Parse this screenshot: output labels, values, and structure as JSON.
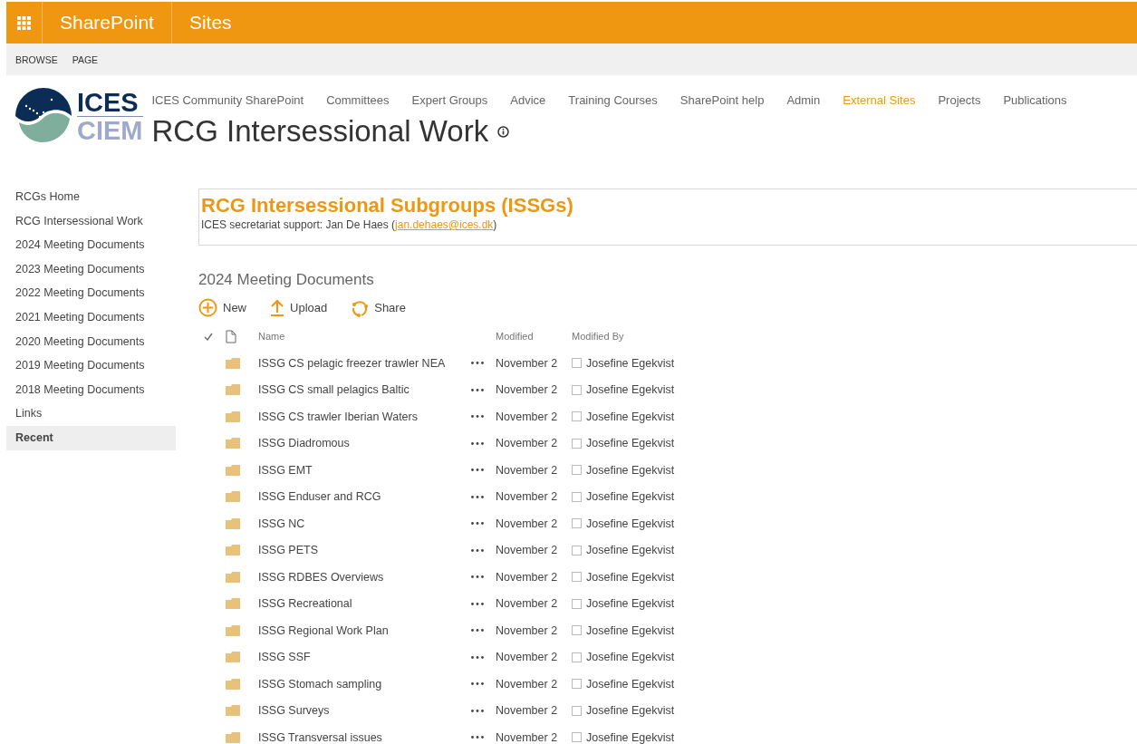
{
  "suite_bar": {
    "app_name": "SharePoint",
    "section": "Sites"
  },
  "ribbon_tabs": [
    {
      "label": "BROWSE"
    },
    {
      "label": "PAGE"
    }
  ],
  "logo": {
    "top": "ICES",
    "bottom": "CIEM"
  },
  "top_nav": [
    {
      "label": "ICES Community SharePoint",
      "selected": false
    },
    {
      "label": "Committees",
      "selected": false
    },
    {
      "label": "Expert Groups",
      "selected": false
    },
    {
      "label": "Advice",
      "selected": false
    },
    {
      "label": "Training Courses",
      "selected": false
    },
    {
      "label": "SharePoint help",
      "selected": false
    },
    {
      "label": "Admin",
      "selected": false
    },
    {
      "label": "External Sites",
      "selected": true
    },
    {
      "label": "Projects",
      "selected": false
    },
    {
      "label": "Publications",
      "selected": false
    }
  ],
  "site_title": "RCG Intersessional Work",
  "sidebar": {
    "items": [
      {
        "label": "RCGs Home",
        "selected": false
      },
      {
        "label": "RCG Intersessional Work",
        "selected": false
      },
      {
        "label": "2024 Meeting Documents",
        "selected": false
      },
      {
        "label": "2023 Meeting Documents",
        "selected": false
      },
      {
        "label": "2022 Meeting Documents",
        "selected": false
      },
      {
        "label": "2021 Meeting Documents",
        "selected": false
      },
      {
        "label": "2020 Meeting Documents",
        "selected": false
      },
      {
        "label": "2019 Meeting Documents",
        "selected": false
      },
      {
        "label": "2018 Meeting Documents",
        "selected": false
      },
      {
        "label": "Links",
        "selected": false
      },
      {
        "label": "Recent",
        "selected": true
      }
    ]
  },
  "banner": {
    "heading": "RCG Intersessional Subgroups (ISSGs)",
    "text_before": "ICES secretariat support: Jan De Haes (",
    "email": "jan.dehaes@ices.dk",
    "text_after": ")"
  },
  "library": {
    "title": "2024 Meeting Documents",
    "actions": [
      {
        "kind": "new",
        "label": "New"
      },
      {
        "kind": "upload",
        "label": "Upload"
      },
      {
        "kind": "share",
        "label": "Share"
      }
    ],
    "columns": {
      "name": "Name",
      "modified": "Modified",
      "modified_by": "Modified By"
    },
    "rows": [
      {
        "name": "ISSG CS pelagic freezer trawler NEA",
        "modified": "November 2",
        "modified_by": "Josefine Egekvist"
      },
      {
        "name": "ISSG CS small pelagics Baltic",
        "modified": "November 2",
        "modified_by": "Josefine Egekvist"
      },
      {
        "name": "ISSG CS trawler Iberian Waters",
        "modified": "November 2",
        "modified_by": "Josefine Egekvist"
      },
      {
        "name": "ISSG Diadromous",
        "modified": "November 2",
        "modified_by": "Josefine Egekvist"
      },
      {
        "name": "ISSG EMT",
        "modified": "November 2",
        "modified_by": "Josefine Egekvist"
      },
      {
        "name": "ISSG Enduser and RCG",
        "modified": "November 2",
        "modified_by": "Josefine Egekvist"
      },
      {
        "name": "ISSG NC",
        "modified": "November 2",
        "modified_by": "Josefine Egekvist"
      },
      {
        "name": "ISSG PETS",
        "modified": "November 2",
        "modified_by": "Josefine Egekvist"
      },
      {
        "name": "ISSG RDBES Overviews",
        "modified": "November 2",
        "modified_by": "Josefine Egekvist"
      },
      {
        "name": "ISSG Recreational",
        "modified": "November 2",
        "modified_by": "Josefine Egekvist"
      },
      {
        "name": "ISSG Regional Work Plan",
        "modified": "November 2",
        "modified_by": "Josefine Egekvist"
      },
      {
        "name": "ISSG SSF",
        "modified": "November 2",
        "modified_by": "Josefine Egekvist"
      },
      {
        "name": "ISSG Stomach sampling",
        "modified": "November 2",
        "modified_by": "Josefine Egekvist"
      },
      {
        "name": "ISSG Surveys",
        "modified": "November 2",
        "modified_by": "Josefine Egekvist"
      },
      {
        "name": "ISSG Transversal issues",
        "modified": "November 2",
        "modified_by": "Josefine Egekvist"
      }
    ]
  }
}
